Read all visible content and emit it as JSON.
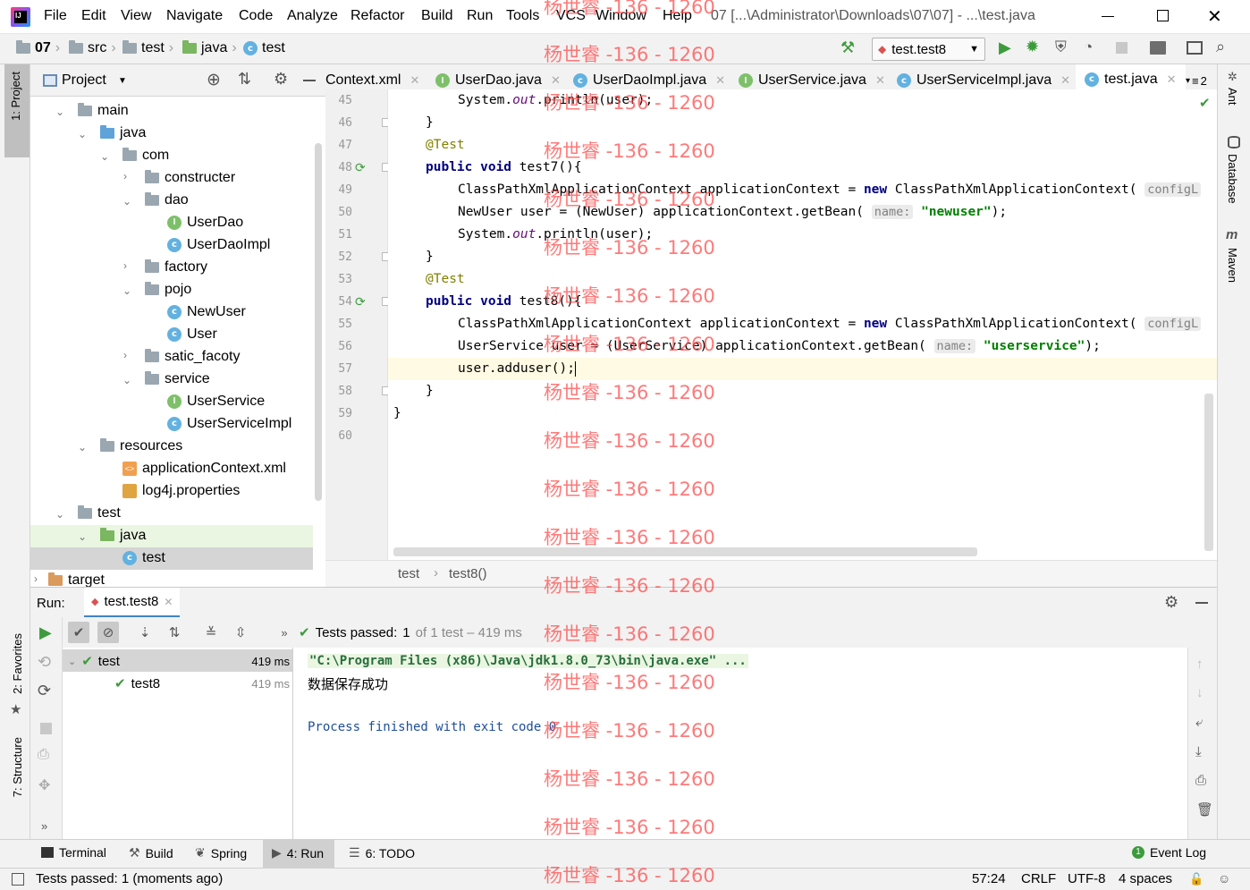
{
  "app": {
    "menu": [
      "File",
      "Edit",
      "View",
      "Navigate",
      "Code",
      "Analyze",
      "Refactor",
      "Build",
      "Run",
      "Tools",
      "VCS",
      "Window",
      "Help"
    ],
    "title": "07 [...\\Administrator\\Downloads\\07\\07] - ...\\test.java"
  },
  "navbar": {
    "crumbs": [
      "07",
      "src",
      "test",
      "java",
      "test"
    ],
    "run_config": "test.test8"
  },
  "watermark": "杨世睿 -136 - 1260",
  "side_tools": {
    "left": [
      "1: Project",
      "2: Favorites",
      "7: Structure"
    ],
    "right": [
      "Ant",
      "Database",
      "Maven"
    ]
  },
  "project": {
    "header": "Project",
    "tree": [
      {
        "label": "main",
        "type": "folder",
        "depth": 1,
        "open": true
      },
      {
        "label": "java",
        "type": "folder-blue",
        "depth": 2,
        "open": true
      },
      {
        "label": "com",
        "type": "folder",
        "depth": 3,
        "open": true
      },
      {
        "label": "constructer",
        "type": "folder",
        "depth": 4,
        "open": false
      },
      {
        "label": "dao",
        "type": "folder",
        "depth": 4,
        "open": true
      },
      {
        "label": "UserDao",
        "type": "interface",
        "depth": 5
      },
      {
        "label": "UserDaoImpl",
        "type": "class",
        "depth": 5
      },
      {
        "label": "factory",
        "type": "folder",
        "depth": 4,
        "open": false
      },
      {
        "label": "pojo",
        "type": "folder",
        "depth": 4,
        "open": true
      },
      {
        "label": "NewUser",
        "type": "class",
        "depth": 5
      },
      {
        "label": "User",
        "type": "class",
        "depth": 5
      },
      {
        "label": "satic_facoty",
        "type": "folder",
        "depth": 4,
        "open": false
      },
      {
        "label": "service",
        "type": "folder",
        "depth": 4,
        "open": true
      },
      {
        "label": "UserService",
        "type": "interface",
        "depth": 5
      },
      {
        "label": "UserServiceImpl",
        "type": "class",
        "depth": 5
      },
      {
        "label": "resources",
        "type": "folder",
        "depth": 2,
        "open": true
      },
      {
        "label": "applicationContext.xml",
        "type": "xml",
        "depth": 3
      },
      {
        "label": "log4j.properties",
        "type": "props",
        "depth": 3
      },
      {
        "label": "test",
        "type": "folder",
        "depth": 1,
        "open": true
      },
      {
        "label": "java",
        "type": "folder-green",
        "depth": 2,
        "open": true
      },
      {
        "label": "test",
        "type": "class",
        "depth": 3,
        "selected": true
      },
      {
        "label": "target",
        "type": "folder-orange",
        "depth": 0,
        "open": false
      }
    ]
  },
  "editor": {
    "tabs": [
      {
        "label": "Context.xml",
        "icon": "xml"
      },
      {
        "label": "UserDao.java",
        "icon": "interface"
      },
      {
        "label": "UserDaoImpl.java",
        "icon": "class"
      },
      {
        "label": "UserService.java",
        "icon": "interface"
      },
      {
        "label": "UserServiceImpl.java",
        "icon": "class"
      },
      {
        "label": "test.java",
        "icon": "class",
        "active": true
      }
    ],
    "tab_overflow": "2",
    "line_numbers": [
      "45",
      "46",
      "47",
      "48",
      "49",
      "50",
      "51",
      "52",
      "53",
      "54",
      "55",
      "56",
      "57",
      "58",
      "59",
      "60"
    ],
    "breadcrumb": [
      "test",
      "test8()"
    ],
    "lines": {
      "l45": "System.",
      "l45b": "out",
      "l45c": ".println(user);",
      "l46": "}",
      "l47": "@Test",
      "l48a": "public void",
      "l48b": " test7(){",
      "l49a": "ClassPathXmlApplicationContext applicationContext = ",
      "l49b": "new",
      "l49c": " ClassPathXmlApplicationContext(",
      "l49d": "configL",
      "l50a": "NewUser user = (NewUser) applicationContext.getBean(",
      "l50b": "name:",
      "l50c": "\"newuser\"",
      "l50d": ");",
      "l51": "System.",
      "l51b": "out",
      "l51c": ".println(user);",
      "l52": "}",
      "l53": "@Test",
      "l54a": "public void",
      "l54b": " test8(){",
      "l55a": "ClassPathXmlApplicationContext applicationContext = ",
      "l55b": "new",
      "l55c": " ClassPathXmlApplicationContext(",
      "l55d": "configL",
      "l56a": "UserService user = (UserService) applicationContext.getBean(",
      "l56b": "name:",
      "l56c": "\"userservice\"",
      "l56d": ");",
      "l57": "user.adduser();",
      "l58": "}",
      "l59": "}"
    }
  },
  "run": {
    "label": "Run:",
    "tab": "test.test8",
    "status_prefix": "Tests passed:",
    "status_count": "1",
    "status_rest": "of 1 test – 419 ms",
    "tests": [
      {
        "name": "test",
        "time": "419 ms"
      },
      {
        "name": "test8",
        "time": "419 ms"
      }
    ],
    "console": [
      "\"C:\\Program Files (x86)\\Java\\jdk1.8.0_73\\bin\\java.exe\" ...",
      "数据保存成功",
      "",
      "Process finished with exit code 0"
    ]
  },
  "bottom_tabs": [
    "Terminal",
    "Build",
    "Spring",
    "4: Run",
    "6: TODO"
  ],
  "event_log": "Event Log",
  "status": {
    "message": "Tests passed: 1 (moments ago)",
    "position": "57:24",
    "line_sep": "CRLF",
    "encoding": "UTF-8",
    "indent": "4 spaces"
  }
}
